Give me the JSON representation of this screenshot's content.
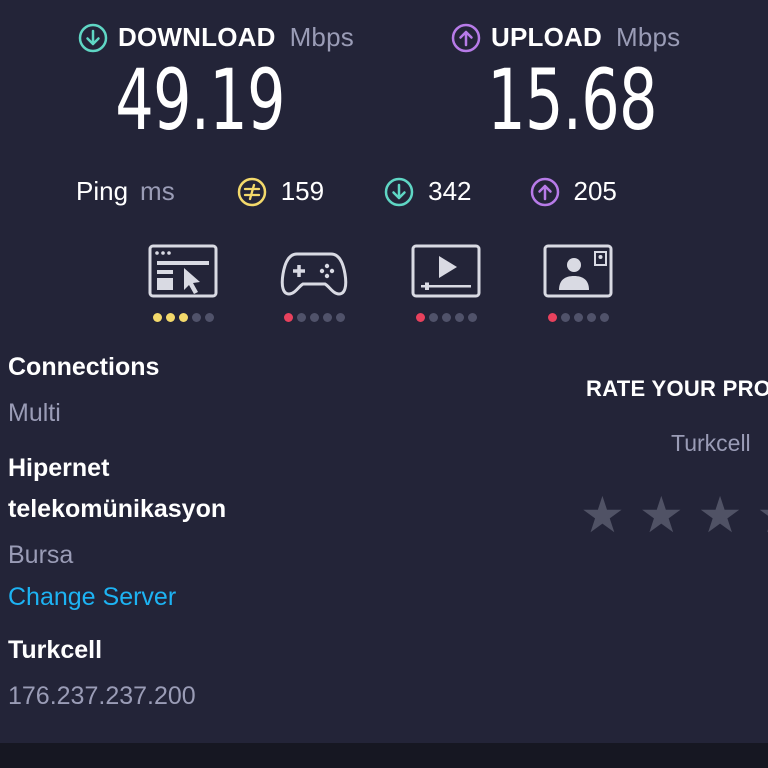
{
  "download": {
    "label": "DOWNLOAD",
    "unit": "Mbps",
    "value": "49.19",
    "icon": "download-arrow-icon",
    "color": "#5fd6c4"
  },
  "upload": {
    "label": "UPLOAD",
    "unit": "Mbps",
    "value": "15.68",
    "icon": "upload-arrow-icon",
    "color": "#b77be8"
  },
  "ping": {
    "label": "Ping",
    "unit": "ms",
    "idle": "159",
    "download": "342",
    "upload": "205",
    "colors": {
      "idle": "#f3d96b",
      "download": "#5fd6c4",
      "upload": "#b77be8"
    }
  },
  "ratings": [
    {
      "name": "web-browsing",
      "icon": "web-browsing-icon",
      "level": 3,
      "max": 5,
      "color": "#f3d96b"
    },
    {
      "name": "gaming",
      "icon": "gamepad-icon",
      "level": 1,
      "max": 5,
      "color": "#e8415d"
    },
    {
      "name": "video-streaming",
      "icon": "video-play-icon",
      "level": 1,
      "max": 5,
      "color": "#e8415d"
    },
    {
      "name": "video-chat",
      "icon": "video-chat-icon",
      "level": 1,
      "max": 5,
      "color": "#e8415d"
    }
  ],
  "info": {
    "connections_label": "Connections",
    "connections_value": "Multi",
    "server_name_line1": "Hipernet",
    "server_name_line2": "telekomünikasyon",
    "server_location": "Bursa",
    "change_server": "Change Server",
    "isp_name": "Turkcell",
    "ip_address": "176.237.237.200"
  },
  "rate": {
    "title": "RATE YOUR PRO",
    "provider": "Turkcell",
    "stars_shown": 4
  }
}
